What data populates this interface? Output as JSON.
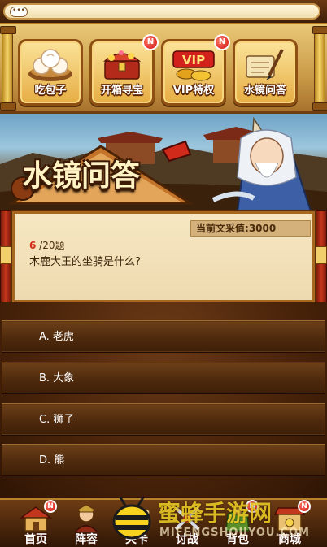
{
  "chat": {
    "icon": "speech-bubble-icon",
    "dots": "•••"
  },
  "menu": {
    "items": [
      {
        "label": "吃包子",
        "icon": "steamed-buns-icon",
        "badge": ""
      },
      {
        "label": "开箱寻宝",
        "icon": "treasure-chest-icon",
        "badge": "N"
      },
      {
        "label": "VIP特权",
        "icon": "vip-coins-icon",
        "badge": "N"
      },
      {
        "label": "水镜问答",
        "icon": "scroll-brush-icon",
        "badge": ""
      }
    ]
  },
  "banner": {
    "title": "水镜问答",
    "character": "sage-character"
  },
  "question": {
    "score_label": "当前文采值:",
    "score_value": "3000",
    "current_number": "6",
    "total_text": " /20题",
    "text": "木鹿大王的坐骑是什么?"
  },
  "answers": [
    {
      "text": "A. 老虎"
    },
    {
      "text": "B. 大象"
    },
    {
      "text": "C. 狮子"
    },
    {
      "text": "D. 熊"
    }
  ],
  "bottom_nav": {
    "items": [
      {
        "label": "首页",
        "icon": "house-icon",
        "badge": "N"
      },
      {
        "label": "阵容",
        "icon": "warrior-icon",
        "badge": ""
      },
      {
        "label": "关卡",
        "icon": "map-icon",
        "badge": ""
      },
      {
        "label": "讨战",
        "icon": "crossed-swords-icon",
        "badge": ""
      },
      {
        "label": "背包",
        "icon": "bag-icon",
        "badge": "N"
      },
      {
        "label": "商城",
        "icon": "shop-icon",
        "badge": "N"
      }
    ]
  },
  "watermark": {
    "text": "蜜蜂手游网",
    "sub": "MIFENGSHOUYOU.COM"
  }
}
